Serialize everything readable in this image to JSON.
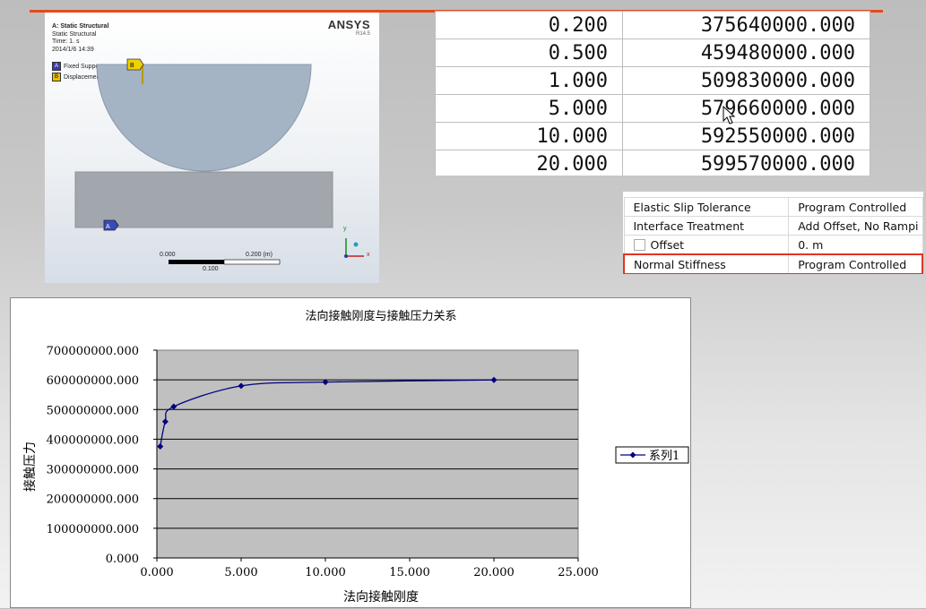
{
  "ansys": {
    "title": "A: Static Structural",
    "subtitle": "Static Structural",
    "time": "Time: 1. s",
    "date": "2014/1/6 14:39",
    "logo": "ANSYS",
    "version": "R14.5",
    "legend": [
      {
        "key": "A",
        "label": "Fixed Support",
        "color": "#3a3aa8"
      },
      {
        "key": "B",
        "label": "Displacement",
        "color": "#e8c000"
      }
    ],
    "scale_left": "0.000",
    "scale_right": "0.200 (m)",
    "scale_mid": "0.100",
    "axis_y": "y",
    "axis_x": "x"
  },
  "stiffness_table": [
    [
      "0.200",
      "375640000.000"
    ],
    [
      "0.500",
      "459480000.000"
    ],
    [
      "1.000",
      "509830000.000"
    ],
    [
      "5.000",
      "579660000.000"
    ],
    [
      "10.000",
      "592550000.000"
    ],
    [
      "20.000",
      "599570000.000"
    ]
  ],
  "properties": [
    {
      "label": "Elastic Slip Tolerance",
      "value": "Program Controlled"
    },
    {
      "label": "Interface Treatment",
      "value": "Add Offset, No Rampi"
    },
    {
      "label": "Offset",
      "value": "0. m"
    },
    {
      "label": "Normal Stiffness",
      "value": "Program Controlled"
    }
  ],
  "chart_data": {
    "type": "line",
    "title": "法向接触刚度与接触压力关系",
    "xlabel": "法向接触刚度",
    "ylabel": "接触压力",
    "xlim": [
      0,
      25
    ],
    "ylim": [
      0,
      700000000
    ],
    "x_ticks": [
      "0.000",
      "5.000",
      "10.000",
      "15.000",
      "20.000",
      "25.000"
    ],
    "y_ticks": [
      "0.000",
      "100000000.000",
      "200000000.000",
      "300000000.000",
      "400000000.000",
      "500000000.000",
      "600000000.000",
      "700000000.000"
    ],
    "series": [
      {
        "name": "系列1",
        "x": [
          0.2,
          0.5,
          1.0,
          5.0,
          10.0,
          20.0
        ],
        "y": [
          375640000,
          459480000,
          509830000,
          579660000,
          592550000,
          599570000
        ]
      }
    ],
    "grid": true,
    "legend_position": "right",
    "colors": {
      "plot_bg": "#c0c0c0",
      "series": "#000080"
    }
  }
}
